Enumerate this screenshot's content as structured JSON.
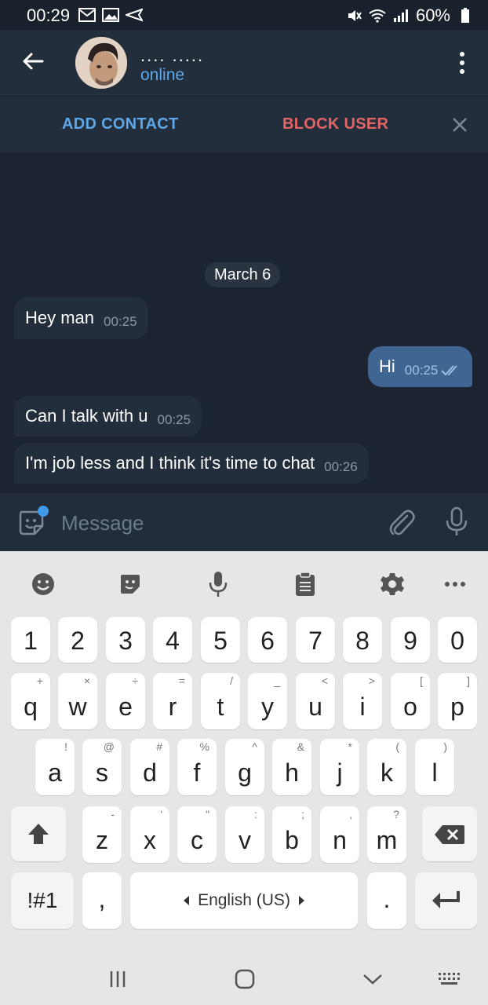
{
  "status_bar": {
    "time": "00:29",
    "battery": "60%"
  },
  "header": {
    "contact_name": ".... .....",
    "contact_status": "online"
  },
  "action_bar": {
    "add_contact": "ADD CONTACT",
    "block_user": "BLOCK USER"
  },
  "chat": {
    "date": "March 6",
    "messages": [
      {
        "direction": "in",
        "text": "Hey man",
        "time": "00:25"
      },
      {
        "direction": "out",
        "text": "Hi",
        "time": "00:25",
        "read": true
      },
      {
        "direction": "in",
        "text": "Can I talk with u",
        "time": "00:25"
      },
      {
        "direction": "in",
        "text": "I'm job less and I think it's time to chat",
        "time": "00:26"
      }
    ]
  },
  "composer": {
    "placeholder": "Message"
  },
  "keyboard": {
    "number_row": [
      "1",
      "2",
      "3",
      "4",
      "5",
      "6",
      "7",
      "8",
      "9",
      "0"
    ],
    "row1": [
      {
        "k": "q",
        "s": "+"
      },
      {
        "k": "w",
        "s": "×"
      },
      {
        "k": "e",
        "s": "÷"
      },
      {
        "k": "r",
        "s": "="
      },
      {
        "k": "t",
        "s": "/"
      },
      {
        "k": "y",
        "s": "_"
      },
      {
        "k": "u",
        "s": "<"
      },
      {
        "k": "i",
        "s": ">"
      },
      {
        "k": "o",
        "s": "["
      },
      {
        "k": "p",
        "s": "]"
      }
    ],
    "row2": [
      {
        "k": "a",
        "s": "!"
      },
      {
        "k": "s",
        "s": "@"
      },
      {
        "k": "d",
        "s": "#"
      },
      {
        "k": "f",
        "s": "%"
      },
      {
        "k": "g",
        "s": "^"
      },
      {
        "k": "h",
        "s": "&"
      },
      {
        "k": "j",
        "s": "*"
      },
      {
        "k": "k",
        "s": "("
      },
      {
        "k": "l",
        "s": ")"
      }
    ],
    "row3": [
      {
        "k": "z",
        "s": "-"
      },
      {
        "k": "x",
        "s": "'"
      },
      {
        "k": "c",
        "s": "\""
      },
      {
        "k": "v",
        "s": ":"
      },
      {
        "k": "b",
        "s": ";"
      },
      {
        "k": "n",
        "s": ","
      },
      {
        "k": "m",
        "s": "?"
      }
    ],
    "symbols_key": "!#1",
    "comma_key": ",",
    "space_label": "English (US)",
    "period_key": "."
  },
  "colors": {
    "accent": "#5ea7e8",
    "danger": "#e26565",
    "outgoing_bubble": "#3f6592",
    "incoming_bubble": "#222e3b"
  }
}
